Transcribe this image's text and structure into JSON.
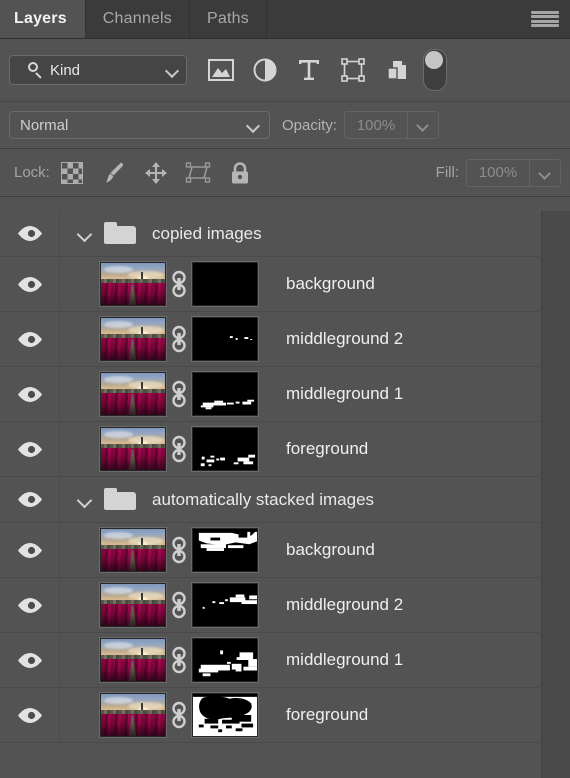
{
  "panel": {
    "tabs": [
      {
        "label": "Layers",
        "active": true
      },
      {
        "label": "Channels",
        "active": false
      },
      {
        "label": "Paths",
        "active": false
      }
    ],
    "menu_icon": "hamburger-menu-icon"
  },
  "filter": {
    "kind_label": "Kind",
    "search_icon": "search-icon",
    "dropdown_icon": "chevron-down-icon",
    "icons": [
      {
        "name": "filter-pixel-layers-icon",
        "title": "Pixel layers"
      },
      {
        "name": "filter-adjustment-layers-icon",
        "title": "Adjustment layers"
      },
      {
        "name": "filter-type-layers-icon",
        "title": "Type layers"
      },
      {
        "name": "filter-shape-layers-icon",
        "title": "Shape layers"
      },
      {
        "name": "filter-smart-objects-icon",
        "title": "Smart objects"
      }
    ],
    "toggle_name": "filter-enable-toggle"
  },
  "blend": {
    "mode": "Normal",
    "mode_dropdown_icon": "chevron-down-icon",
    "opacity_label": "Opacity:",
    "opacity_value": "100%",
    "opacity_stepper_icon": "chevron-down-icon"
  },
  "lock": {
    "label": "Lock:",
    "icons": [
      {
        "name": "lock-transparent-pixels-icon"
      },
      {
        "name": "lock-image-pixels-brush-icon"
      },
      {
        "name": "lock-position-move-icon"
      },
      {
        "name": "lock-artboard-nesting-icon"
      },
      {
        "name": "lock-all-padlock-icon"
      }
    ],
    "fill_label": "Fill:",
    "fill_value": "100%",
    "fill_stepper_icon": "chevron-down-icon"
  },
  "layers": [
    {
      "type": "group",
      "name": "copied images",
      "visible": true,
      "expanded": true,
      "visibility_icon": "eye-icon",
      "expand_icon": "chevron-down-icon",
      "folder_icon": "folder-icon"
    },
    {
      "type": "layer",
      "name": "background",
      "visible": true,
      "visibility_icon": "eye-icon",
      "link_icon": "mask-link-icon",
      "mask_id": "m1"
    },
    {
      "type": "layer",
      "name": "middleground 2",
      "visible": true,
      "visibility_icon": "eye-icon",
      "link_icon": "mask-link-icon",
      "mask_id": "m2"
    },
    {
      "type": "layer",
      "name": "middleground 1",
      "visible": true,
      "visibility_icon": "eye-icon",
      "link_icon": "mask-link-icon",
      "mask_id": "m3"
    },
    {
      "type": "layer",
      "name": "foreground",
      "visible": true,
      "visibility_icon": "eye-icon",
      "link_icon": "mask-link-icon",
      "mask_id": "m4"
    },
    {
      "type": "group",
      "name": "automatically stacked images",
      "visible": true,
      "expanded": true,
      "visibility_icon": "eye-icon",
      "expand_icon": "chevron-down-icon",
      "folder_icon": "folder-icon"
    },
    {
      "type": "layer",
      "name": "background",
      "visible": true,
      "visibility_icon": "eye-icon",
      "link_icon": "mask-link-icon",
      "mask_id": "m5"
    },
    {
      "type": "layer",
      "name": "middleground 2",
      "visible": true,
      "visibility_icon": "eye-icon",
      "link_icon": "mask-link-icon",
      "mask_id": "m6"
    },
    {
      "type": "layer",
      "name": "middleground 1",
      "visible": true,
      "visibility_icon": "eye-icon",
      "link_icon": "mask-link-icon",
      "mask_id": "m7"
    },
    {
      "type": "layer",
      "name": "foreground",
      "visible": true,
      "visibility_icon": "eye-icon",
      "link_icon": "mask-link-icon",
      "mask_id": "m8"
    }
  ],
  "colors": {
    "panel_bg": "#535353",
    "tabbar_bg": "#3b3b3b",
    "text": "#e9e9e9",
    "muted_text": "#a4a4a4",
    "divider": "#4a4a4a",
    "scrollbar_track": "#4a4a4a"
  }
}
